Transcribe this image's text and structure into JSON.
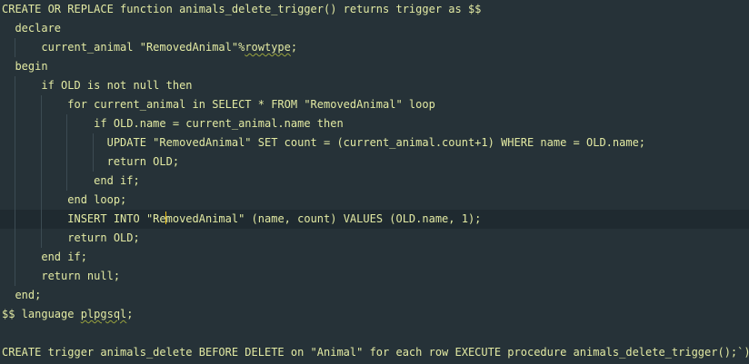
{
  "editor": {
    "lines": [
      "CREATE OR REPLACE function animals_delete_trigger() returns trigger as $$",
      "  declare",
      "      current_animal \"RemovedAnimal\"%rowtype;",
      "  begin",
      "      if OLD is not null then",
      "          for current_animal in SELECT * FROM \"RemovedAnimal\" loop",
      "              if OLD.name = current_animal.name then",
      "                UPDATE \"RemovedAnimal\" SET count = (current_animal.count+1) WHERE name = OLD.name;",
      "                return OLD;",
      "              end if;",
      "          end loop;",
      "          INSERT INTO \"RemovedAnimal\" (name, count) VALUES (OLD.name, 1);",
      "          return OLD;",
      "      end if;",
      "      return null;",
      "  end;",
      "$$ language plpgsql;",
      "",
      "CREATE trigger animals_delete BEFORE DELETE on \"Animal\" for each row EXECUTE procedure animals_delete_trigger();`)"
    ],
    "current_line": 11,
    "colors": {
      "background": "#263238",
      "text": "#e3eaa3",
      "current_line_highlight": "#1f2a30",
      "caret": "#f0c419",
      "indent_guide": "#3c4b53"
    }
  }
}
